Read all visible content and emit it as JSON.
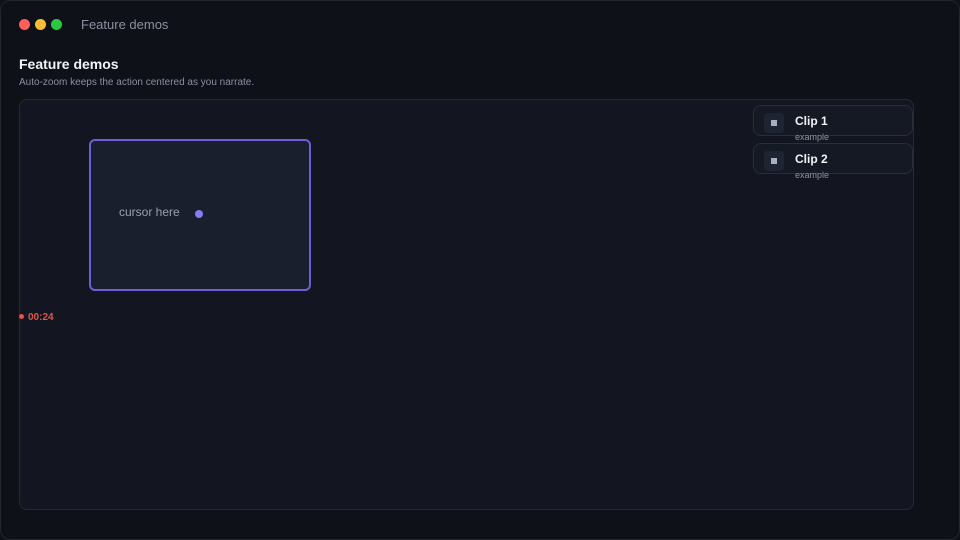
{
  "window": {
    "title": "Feature demos",
    "controls": {
      "close_color": "#ff5f57",
      "minimize_color": "#febc2e",
      "maximize_color": "#28c840"
    }
  },
  "page": {
    "title": "Feature demos",
    "subtitle": "Auto-zoom keeps the action centered as you narrate."
  },
  "stage": {
    "zoom_label": "cursor here",
    "recording_time": "00:24",
    "accent_color": "#6f5fd6",
    "recording_color": "#e5534b"
  },
  "clips": [
    {
      "title": "Clip 1",
      "subtitle": "example",
      "icon": "stop-square-icon"
    },
    {
      "title": "Clip 2",
      "subtitle": "example",
      "icon": "stop-square-icon"
    }
  ]
}
